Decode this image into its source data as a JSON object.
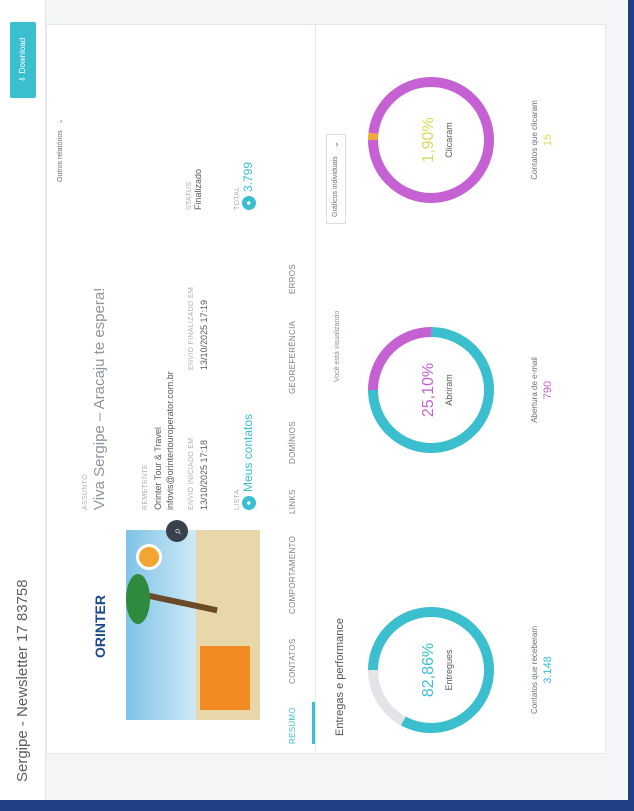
{
  "header": {
    "title": "Sergipe - Newsletter 17 83758"
  },
  "actions": {
    "download_label": "Download",
    "outros_label": "Outros relatórios"
  },
  "campaign": {
    "thumbnail_logo": "ORINTER",
    "subject_label": "ASSUNTO",
    "subject": "Viva Sergipe – Aracaju te espera!",
    "sender_label": "REMETENTE",
    "sender_name": "Orinter Tour & Travel",
    "sender_email": "infovis@orintertouroperator.com.br",
    "sent_label": "ENVIO INICIADO EM",
    "sent_date": "13/10/2025 17:18",
    "finished_label": "ENVIO FINALIZADO EM",
    "finished_date": "13/10/2025 17:19",
    "status_label": "STATUS",
    "status": "Finalizado",
    "contacts_label": "LISTA",
    "contacts_link": "Meus contatos",
    "total_label": "TOTAL",
    "total": "3.799"
  },
  "tabs": [
    {
      "label": "RESUMO"
    },
    {
      "label": "CONTATOS"
    },
    {
      "label": "COMPORTAMENTO"
    },
    {
      "label": "LINKS"
    },
    {
      "label": "DOMÍNIOS"
    },
    {
      "label": "GEOREFERÊNCIA"
    },
    {
      "label": "ERROS"
    }
  ],
  "performance": {
    "title": "Entregas e performance",
    "viewing_label": "Você está visualizando",
    "select_value": "Gráficos individuais"
  },
  "colors": {
    "accent": "#3bbfcf",
    "magenta": "#c561d2",
    "gray": "#e2e4e8",
    "orange": "#f0a83a",
    "yellow": "#d8dc5a"
  },
  "chart_data": [
    {
      "type": "pie",
      "percent_label": "82,86%",
      "label": "Entregues",
      "caption": "Contatos que receberam",
      "count": "3.148",
      "values": [
        82.86,
        17.14
      ],
      "colors": [
        "#3bbfcf",
        "#e2e4e8"
      ]
    },
    {
      "type": "pie",
      "percent_label": "25,10%",
      "label": "Abriram",
      "caption": "Abertura de e-mail",
      "count": "790",
      "values": [
        25.1,
        74.9
      ],
      "colors": [
        "#c561d2",
        "#3bbfcf"
      ]
    },
    {
      "type": "pie",
      "percent_label": "1,90%",
      "label": "Clicaram",
      "caption": "Contatos que clicaram",
      "count": "15",
      "values": [
        1.9,
        98.1
      ],
      "colors": [
        "#f0a83a",
        "#c561d2"
      ]
    }
  ]
}
